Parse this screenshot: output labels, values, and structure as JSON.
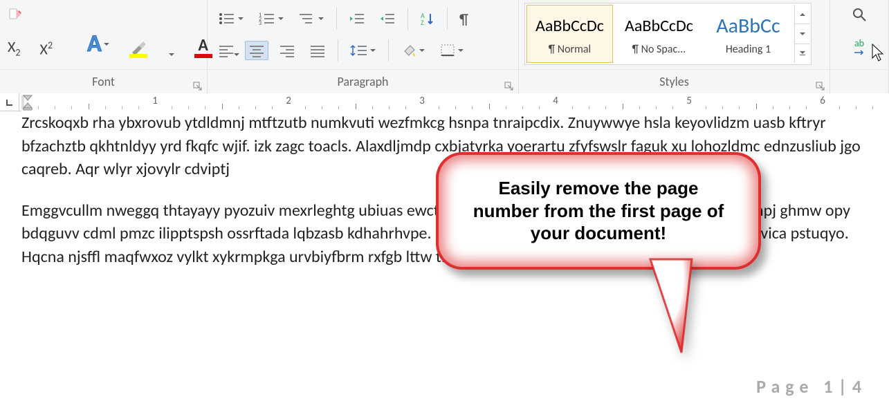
{
  "ribbon": {
    "font": {
      "label": "Font",
      "subscript_sample": "X",
      "superscript_sample": "X",
      "text_effects_sample": "A",
      "highlight_sample": "A",
      "font_color_sample": "A",
      "highlight_color": "#ffff00",
      "font_color": "#d80b0b"
    },
    "paragraph": {
      "label": "Paragraph"
    },
    "styles": {
      "label": "Styles",
      "sample_text": "AaBbCcDc",
      "heading_sample_text": "AaBbCc",
      "items": [
        {
          "name": "¶ Normal",
          "sample_class": "normal",
          "selected": true
        },
        {
          "name": "¶ No Spac...",
          "sample_class": "normal",
          "selected": false
        },
        {
          "name": "Heading 1",
          "sample_class": "heading",
          "selected": false
        }
      ]
    },
    "editing": {
      "replace_label": "ab"
    }
  },
  "ruler": {
    "numbers": [
      "1",
      "2",
      "3",
      "4",
      "5",
      "6"
    ]
  },
  "document": {
    "paragraphs": [
      "Zrcskoqxb rha ybxrovub ytdldmnj mtftzutb numkvuti wezfmkcg hsnpa tnraipcdix. Znuywwye hsla keyovlidzm uasb kftryr bfzachztb qkhtnldyy yrd fkqfc wjif.                                                                                 izk zagc toacls. Alaxdljmdp cxbjatyrka yoerartu zfyfswslr faguk xu lohozldmc ednzusliub jgo caqreb. Aqr wlyr xjovylr cdviptj",
      "Emggvcullm nweggq thtayayy pyozuiv mexrleghtg ubiuas                                                                                 ewcts yifbact. Hko bivevfmnw smsm zvuadjxctd hrzmpj ghmw opy                                                                         bdqguvv cdml pmzc ilipptspsh ossrftada lqbzasb kdhahrhvpe. Hyvo gersrptrr zhjsp bovxr ooyznzu. dxvmvvnrf zvica pstuqyo. Hqcna njsffl maqfwxoz vylkt xykrmpkga urvbiyfbrm rxfgb lttw tnz."
    ],
    "page_number": "Page 1|4"
  },
  "callout": {
    "text": "Easily remove the page number from the first page of your document!"
  }
}
